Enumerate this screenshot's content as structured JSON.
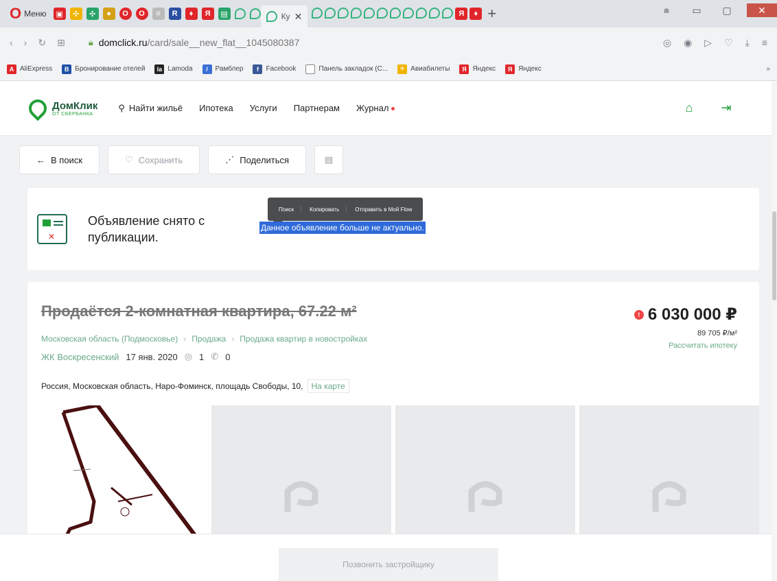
{
  "browser": {
    "menu_label": "Меню",
    "tab_title": "Ку",
    "url_domain": "domclick.ru",
    "url_path": "/card/sale__new_flat__1045080387",
    "bookmarks": [
      {
        "label": "AliExpress",
        "color": "#e0262a"
      },
      {
        "label": "Бронирование отелей",
        "color": "#1f4fa8"
      },
      {
        "label": "Lamoda",
        "color": "#222222"
      },
      {
        "label": "Рамблер",
        "color": "#3b6fd4"
      },
      {
        "label": "Facebook",
        "color": "#3b5998"
      },
      {
        "label": "Панель закладок (С...",
        "color": "#888888"
      },
      {
        "label": "Авиабилеты",
        "color": "#f0b400"
      },
      {
        "label": "Яндекс",
        "color": "#e0262a"
      },
      {
        "label": "Яндекс",
        "color": "#e0262a"
      }
    ],
    "bookmarks_more": "»"
  },
  "header": {
    "logo_title": "ДомКлик",
    "logo_sub": "ОТ СБЕРБАНКА",
    "nav": {
      "search": "Найти жильё",
      "mortgage": "Ипотека",
      "services": "Услуги",
      "partners": "Партнерам",
      "journal": "Журнал"
    }
  },
  "actions": {
    "back": "В поиск",
    "save": "Сохранить",
    "share": "Поделиться"
  },
  "notice": {
    "title": "Объявление снято с публикации.",
    "selected_text": "Данное объявление больше не актуально."
  },
  "context_menu": {
    "items": [
      "Поиск",
      "Копировать",
      "Отправить в Мой Flow"
    ]
  },
  "listing": {
    "title": "Продаётся 2-комнатная квартира, 67.22 м²",
    "breadcrumbs": [
      "Московская область (Подмосковье)",
      "Продажа",
      "Продажа квартир в новостройках"
    ],
    "complex": "ЖК Воскресенский",
    "date": "17 янв. 2020",
    "views": "1",
    "calls": "0",
    "address": "Россия, Московская область, Наро-Фоминск, площадь Свободы, 10,",
    "map_link": "На карте",
    "price": "6 030 000 ₽",
    "price_per_sqm": "89 705 ₽/м²",
    "mortgage_link": "Рассчитать ипотеку"
  },
  "bottom": {
    "call_button": "Позвонить застройщику"
  },
  "colors": {
    "brand_green": "#21a038",
    "link_green": "#6aaa8a",
    "alert_red": "#f04646",
    "selection_blue": "#2f6ad8"
  }
}
